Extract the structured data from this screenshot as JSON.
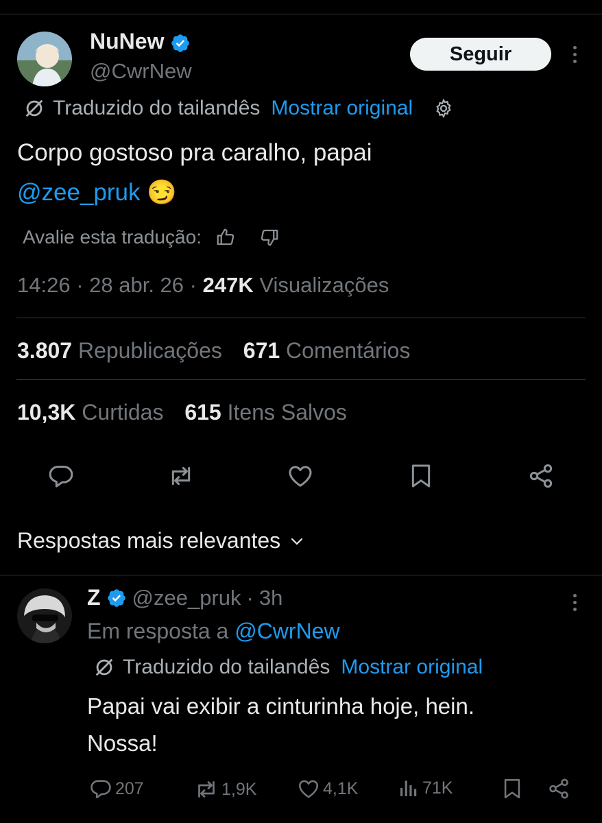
{
  "tweet": {
    "author_name": "NuNew",
    "author_handle": "@CwrNew",
    "follow_label": "Seguir",
    "translated_label": "Traduzido do tailandês",
    "show_original": "Mostrar original",
    "body_line1": "Corpo gostoso pra caralho, papai",
    "mention": "@zee_pruk",
    "emoji": "😏",
    "rate_label": "Avalie esta tradução:",
    "time": "14:26",
    "date": "28 abr. 26",
    "views_count": "247K",
    "views_label": "Visualizações",
    "reposts_count": "3.807",
    "reposts_label": "Republicações",
    "comments_count": "671",
    "comments_label": "Comentários",
    "likes_count": "10,3K",
    "likes_label": "Curtidas",
    "saves_count": "615",
    "saves_label": "Itens Salvos"
  },
  "replies_sort_label": "Respostas mais relevantes",
  "reply": {
    "author_name": "Z",
    "author_handle": "@zee_pruk",
    "time_ago": "3h",
    "in_reply_prefix": "Em resposta a",
    "in_reply_handle": "@CwrNew",
    "translated_label": "Traduzido do tailandês",
    "show_original": "Mostrar original",
    "body_line1": "Papai vai exibir a cinturinha hoje, hein.",
    "body_line2": "Nossa!",
    "replies": "207",
    "reposts": "1,9K",
    "likes": "4,1K",
    "views": "71K"
  },
  "colors": {
    "accent": "#1d9bf0",
    "background": "#000000",
    "muted": "#71767b",
    "text": "#e7e9ea"
  },
  "icons": [
    "verified-badge-icon",
    "translate-icon",
    "gear-icon",
    "thumbs-up-icon",
    "thumbs-down-icon",
    "reply-icon",
    "repost-icon",
    "like-icon",
    "bookmark-icon",
    "share-icon",
    "chevron-down-icon",
    "views-icon",
    "more-icon"
  ]
}
